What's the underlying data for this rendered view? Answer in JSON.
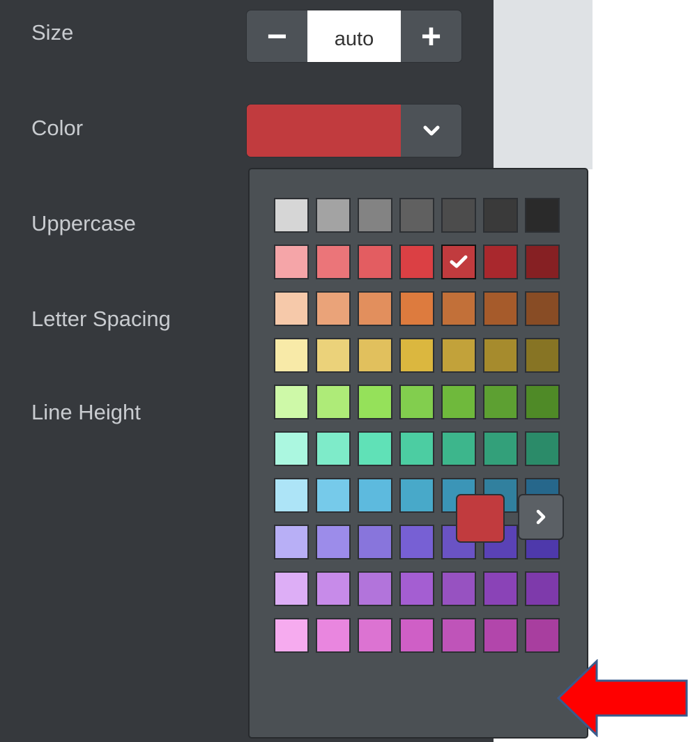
{
  "panel": {
    "labels": {
      "size": "Size",
      "color": "Color",
      "uppercase": "Uppercase",
      "letter_spacing": "Letter Spacing",
      "line_height": "Line Height"
    },
    "size_stepper": {
      "minus": "−",
      "value": "auto",
      "plus": "+"
    },
    "color_select": {
      "value_color": "#c13b3e",
      "chevron_icon": "chevron-down-icon"
    }
  },
  "color_picker": {
    "selected": {
      "row": 1,
      "col": 4
    },
    "current_color": "#c13b3e",
    "more_icon": "chevron-right-icon",
    "palette": [
      [
        "#d6d6d6",
        "#a3a3a3",
        "#838383",
        "#606060",
        "#4c4c4c",
        "#3a3a3a",
        "#2a2a2a"
      ],
      [
        "#f5a5a8",
        "#eb7579",
        "#e35d61",
        "#db4044",
        "#c13b3e",
        "#a9282d",
        "#862023"
      ],
      [
        "#f6c9aa",
        "#eaa379",
        "#e28f5d",
        "#dd7b3e",
        "#c27039",
        "#a65b2b",
        "#884c25"
      ],
      [
        "#f8eaa8",
        "#ebd27a",
        "#e1c05d",
        "#dbb73f",
        "#c2a23a",
        "#a68b2d",
        "#877424"
      ],
      [
        "#cef9a8",
        "#aeeb78",
        "#95e15a",
        "#82ce4e",
        "#6fb93c",
        "#5da032",
        "#4f8a27"
      ],
      [
        "#abf7e0",
        "#7eebc9",
        "#60e1b7",
        "#4ccda2",
        "#3db68c",
        "#33a07a",
        "#2b8b69"
      ],
      [
        "#ade4f7",
        "#76caea",
        "#5dbade",
        "#48a9c9",
        "#3b95b7",
        "#31809e",
        "#26678b"
      ],
      [
        "#b8aff6",
        "#9c8cea",
        "#8875dc",
        "#7760d4",
        "#6a53c4",
        "#5a42b6",
        "#4e39ab"
      ],
      [
        "#ddaef6",
        "#c78be9",
        "#b274db",
        "#a45ed2",
        "#9752c1",
        "#8a43b7",
        "#7e3aab"
      ],
      [
        "#f6abef",
        "#e986df",
        "#dc73d2",
        "#cf5fc6",
        "#bf54b9",
        "#b246ab",
        "#a83e9f"
      ]
    ]
  },
  "annotation": {
    "arrow_color": "#ff0000",
    "arrow_border": "#3a5b8c"
  }
}
